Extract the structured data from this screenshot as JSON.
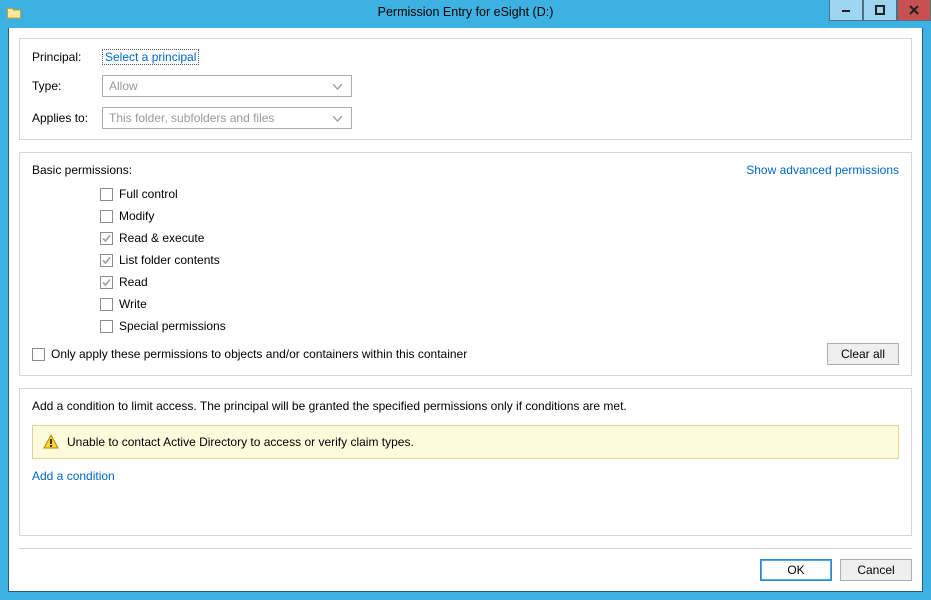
{
  "window": {
    "title": "Permission Entry for eSight (D:)"
  },
  "form": {
    "principal_label": "Principal:",
    "select_principal_link": "Select a principal",
    "type_label": "Type:",
    "type_value": "Allow",
    "applies_label": "Applies to:",
    "applies_value": "This folder, subfolders and files"
  },
  "permissions": {
    "header": "Basic permissions:",
    "advanced_link": "Show advanced permissions",
    "items": [
      {
        "label": "Full control",
        "checked": false
      },
      {
        "label": "Modify",
        "checked": false
      },
      {
        "label": "Read & execute",
        "checked": true
      },
      {
        "label": "List folder contents",
        "checked": true
      },
      {
        "label": "Read",
        "checked": true
      },
      {
        "label": "Write",
        "checked": false
      },
      {
        "label": "Special permissions",
        "checked": false
      }
    ],
    "only_apply_label": "Only apply these permissions to objects and/or containers within this container",
    "only_apply_checked": false,
    "clear_all": "Clear all"
  },
  "conditions": {
    "intro": "Add a condition to limit access. The principal will be granted the specified permissions only if conditions are met.",
    "warning": "Unable to contact Active Directory to access or verify claim types.",
    "add_link": "Add a condition"
  },
  "footer": {
    "ok": "OK",
    "cancel": "Cancel"
  }
}
